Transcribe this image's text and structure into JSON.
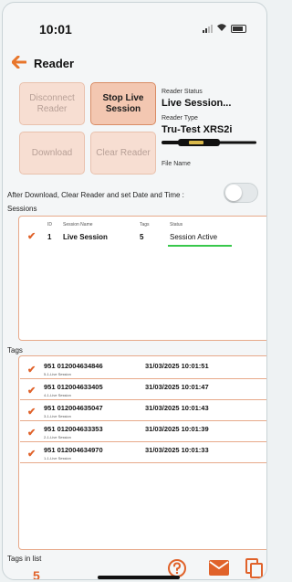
{
  "status_bar": {
    "time": "10:01"
  },
  "header": {
    "title": "Reader"
  },
  "buttons": {
    "disconnect": "Disconnect Reader",
    "stop_live": "Stop Live Session",
    "download": "Download",
    "clear_reader": "Clear Reader"
  },
  "reader": {
    "status_label": "Reader Status",
    "status_value": "Live Session...",
    "type_label": "Reader Type",
    "type_value": "Tru-Test XRS2i",
    "file_name_label": "File Name"
  },
  "after_download_label": "After Download, Clear Reader and set Date and Time :",
  "sessions": {
    "label": "Sessions",
    "columns": {
      "id": "ID",
      "name": "Session Name",
      "tags": "Tags",
      "status": "Status"
    },
    "rows": [
      {
        "id": "1",
        "name": "Live Session",
        "tags": "5",
        "status": "Session Active"
      }
    ]
  },
  "tags": {
    "label": "Tags",
    "rows": [
      {
        "number": "951 012004634846",
        "session": "5-1-Live Session",
        "time": "31/03/2025 10:01:51"
      },
      {
        "number": "951 012004633405",
        "session": "4-1-Live Session",
        "time": "31/03/2025 10:01:47"
      },
      {
        "number": "951 012004635047",
        "session": "3-1-Live Session",
        "time": "31/03/2025 10:01:43"
      },
      {
        "number": "951 012004633353",
        "session": "2-1-Live Session",
        "time": "31/03/2025 10:01:39"
      },
      {
        "number": "951 012004634970",
        "session": "1-1-Live Session",
        "time": "31/03/2025 10:01:33"
      }
    ]
  },
  "footer": {
    "tags_in_list_label": "Tags in list",
    "tags_in_list_count": "5"
  },
  "colors": {
    "accent": "#e0622a",
    "active_button": "#f3c7b1",
    "disabled_button": "#f7ded2",
    "panel_border": "#e7a98a",
    "session_active": "#38c84b"
  }
}
